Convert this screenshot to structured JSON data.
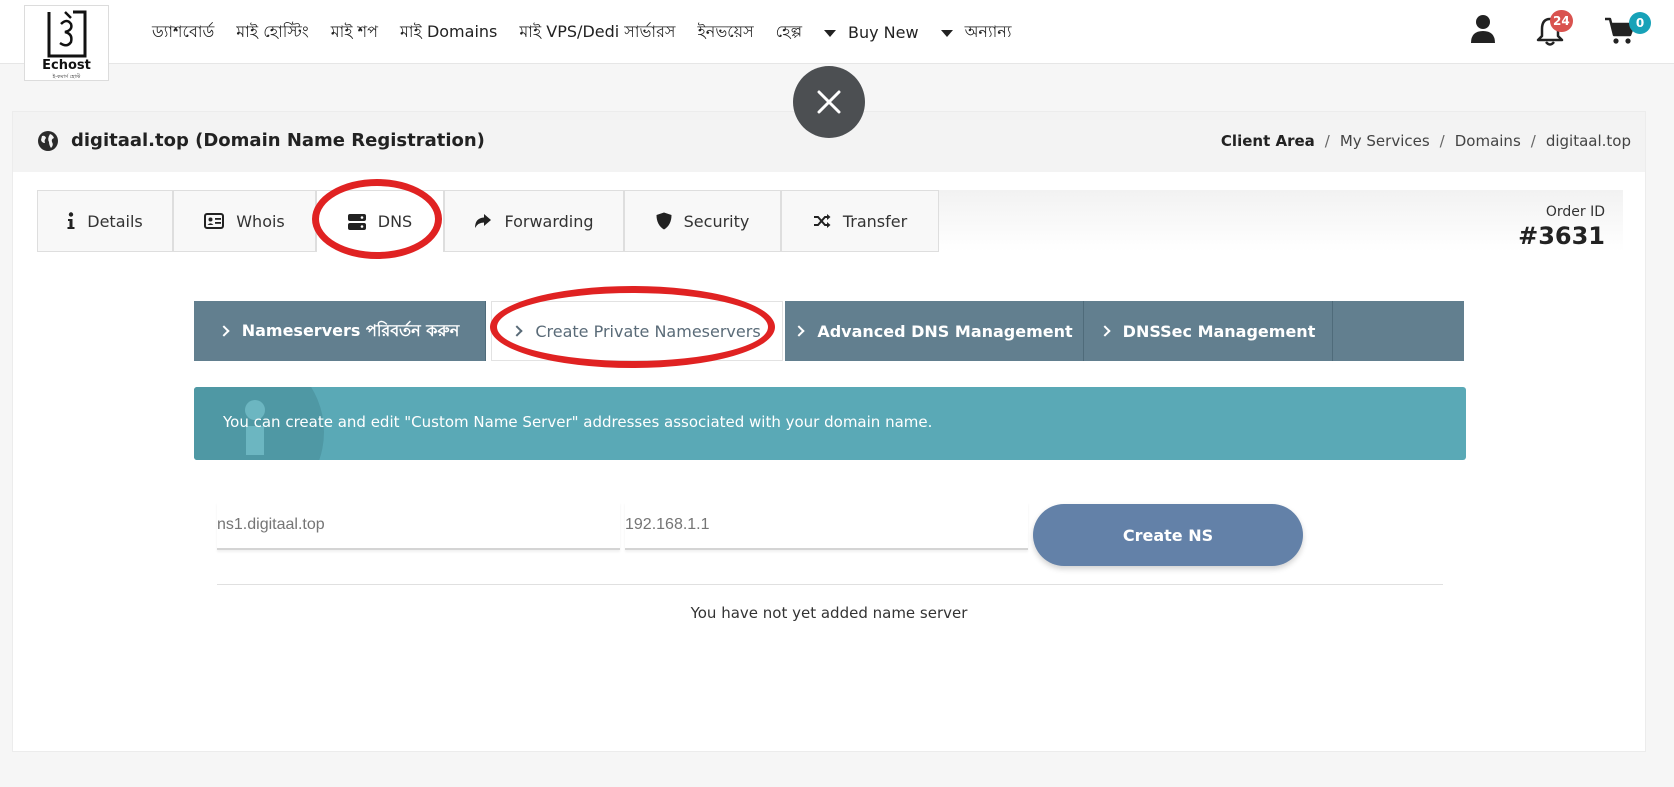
{
  "brand": {
    "logo_text": "Echost",
    "logo_sub": "ই-কমার্স হোস্ট"
  },
  "nav": {
    "items": [
      "ড্যাশবোর্ড",
      "মাই হোস্টিং",
      "মাই শপ",
      "মাই Domains",
      "মাই VPS/Dedi সার্ভারস",
      "ইনভয়েস",
      "হেল্প"
    ],
    "buy_new": "Buy New",
    "others": "অন্যান্য"
  },
  "header_icons": {
    "user": "user-icon",
    "notifications": {
      "icon": "bell-icon",
      "count": "24",
      "color": "#d9534f"
    },
    "cart": {
      "icon": "cart-icon",
      "count": "0",
      "color": "#17a2b8"
    }
  },
  "page": {
    "title": "digitaal.top (Domain Name Registration)",
    "breadcrumb": [
      "Client Area",
      "My Services",
      "Domains",
      "digitaal.top"
    ]
  },
  "tabs": [
    {
      "label": "Details",
      "icon": "info-icon"
    },
    {
      "label": "Whois",
      "icon": "id-card-icon"
    },
    {
      "label": "DNS",
      "icon": "server-icon"
    },
    {
      "label": "Forwarding",
      "icon": "share-icon"
    },
    {
      "label": "Security",
      "icon": "shield-icon"
    },
    {
      "label": "Transfer",
      "icon": "shuffle-icon"
    }
  ],
  "order": {
    "label": "Order ID",
    "value": "#3631"
  },
  "subtabs": [
    "Nameservers পরিবর্তন করুন",
    "Create Private Nameservers",
    "Advanced DNS Management",
    "DNSSec Management"
  ],
  "info": {
    "text": "You can create and edit \"Custom Name Server\" addresses associated with your domain name."
  },
  "form": {
    "ns_placeholder": "ns1.digitaal.top",
    "ip_placeholder": "192.168.1.1",
    "button": "Create NS"
  },
  "empty_message": "You have not yet added name server",
  "colors": {
    "subtab_bg": "#627f8f",
    "info_bg": "#5aa9b6",
    "button_bg": "#6381a8",
    "annotation": "#e02222"
  }
}
